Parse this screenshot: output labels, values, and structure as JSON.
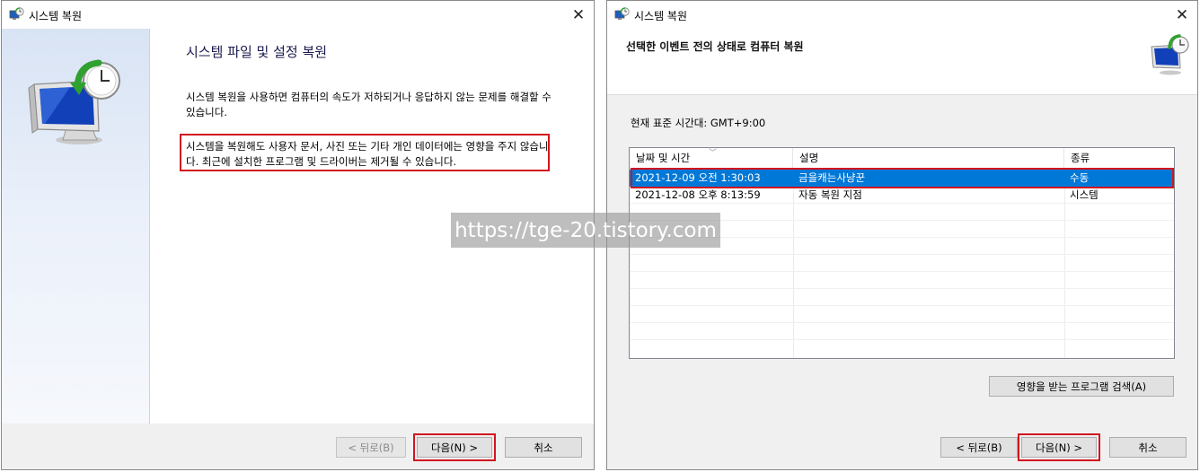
{
  "window1": {
    "title": "시스템 복원",
    "close": "✕",
    "heading": "시스템 파일 및 설정 복원",
    "paragraph1": "시스템 복원을 사용하면 컴퓨터의 속도가 저하되거나 응답하지 않는 문제를 해결할 수 있습니다.",
    "paragraph2": "시스템을 복원해도 사용자 문서, 사진 또는 기타 개인 데이터에는 영향을 주지 않습니다. 최근에 설치한 프로그램 및 드라이버는 제거될 수 있습니다.",
    "buttons": {
      "back": "< 뒤로(B)",
      "next": "다음(N) >",
      "cancel": "취소"
    }
  },
  "window2": {
    "title": "시스템 복원",
    "close": "✕",
    "heading": "선택한 이벤트 전의 상태로 컴퓨터 복원",
    "timezone": "현재 표준 시간대: GMT+9:00",
    "table": {
      "columns": [
        "날짜 및 시간",
        "설명",
        "종류"
      ],
      "rows": [
        {
          "date": "2021-12-09 오전 1:30:03",
          "desc": "금을캐는사냥꾼",
          "type": "수동",
          "selected": true
        },
        {
          "date": "2021-12-08 오후 8:13:59",
          "desc": "자동 복원 지점",
          "type": "시스템",
          "selected": false
        }
      ]
    },
    "scan_button": "영향을 받는 프로그램 검색(A)",
    "buttons": {
      "back": "< 뒤로(B)",
      "next": "다음(N) >",
      "cancel": "취소"
    }
  },
  "watermark": "https://tge-20.tistory.com",
  "colors": {
    "highlight": "#d2141f",
    "selection": "#0078d7",
    "accent": "#1a1a4e"
  },
  "icons": {
    "title": "system-restore-icon",
    "hero": "restore-monitor-clock-icon",
    "close": "close-icon"
  }
}
